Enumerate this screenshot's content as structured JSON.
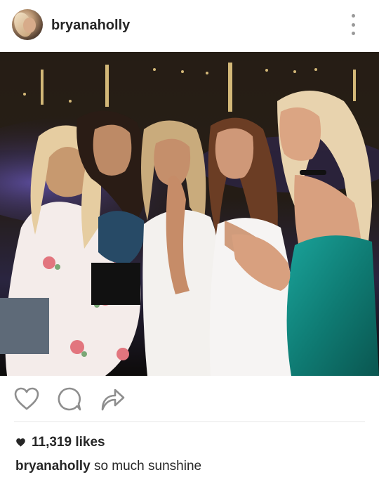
{
  "post": {
    "username": "bryanaholly",
    "likes_text": "11,319 likes",
    "caption_user": "bryanaholly",
    "caption_text": "so much sunshine"
  },
  "icons": {
    "more": "more-vertical-icon",
    "like": "heart-outline-icon",
    "comment": "comment-bubble-icon",
    "share": "share-arrow-icon",
    "likes_heart": "heart-filled-icon"
  },
  "colors": {
    "text": "#262626",
    "icon": "#8e8e8e",
    "divider": "#e6e6e6"
  }
}
